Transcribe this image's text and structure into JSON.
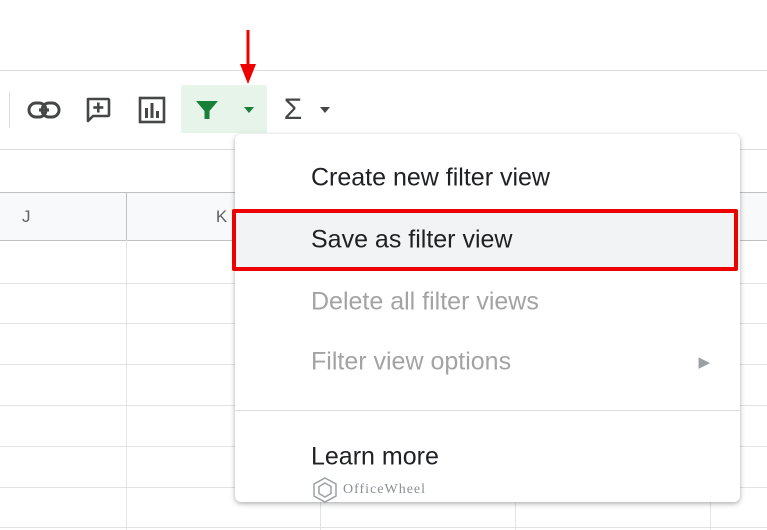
{
  "columns": [
    "J",
    "K"
  ],
  "filter_menu": {
    "items": [
      {
        "label": "Create new filter view",
        "state": "enabled"
      },
      {
        "label": "Save as filter view",
        "state": "highlighted"
      },
      {
        "label": "Delete all filter views",
        "state": "disabled"
      },
      {
        "label": "Filter view options",
        "state": "disabled",
        "has_submenu": true
      }
    ],
    "footer_item": {
      "label": "Learn more",
      "state": "enabled"
    },
    "submenu_glyph": "▶"
  },
  "toolbar": {
    "icons": [
      "link-icon",
      "comment-icon",
      "chart-icon",
      "filter-icon",
      "filter-dropdown-icon",
      "functions-icon",
      "chevron-down-icon"
    ],
    "functions_glyph": "Σ"
  },
  "annotations": {
    "arrow_color": "#ec0000",
    "highlight_box_color": "#ec0000"
  },
  "watermark": {
    "text": "OfficeWheel"
  },
  "colors": {
    "filter_active_bg": "#e6f4ea",
    "filter_icon": "#188038",
    "menu_highlight": "#f1f3f4",
    "disabled_text": "#a3a3a3"
  }
}
